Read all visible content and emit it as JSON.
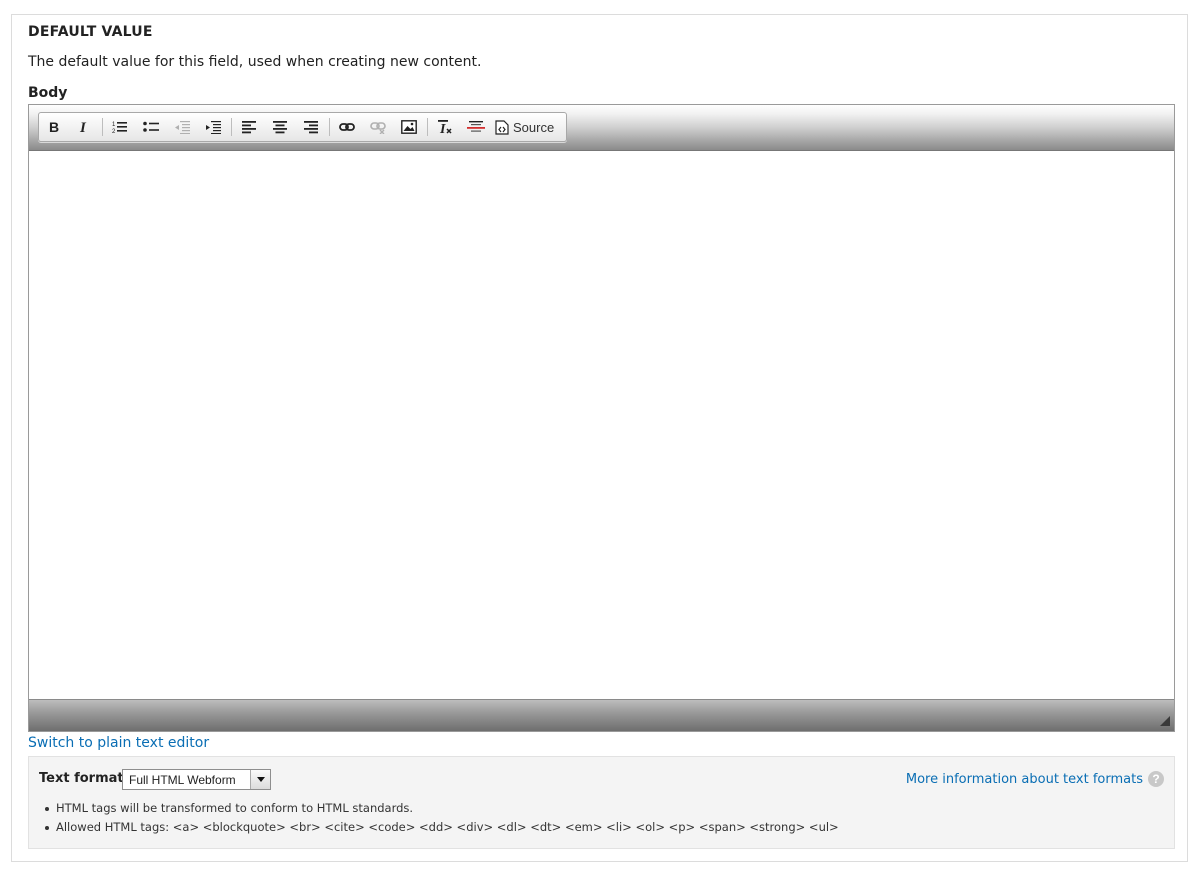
{
  "fieldset": {
    "legend": "DEFAULT VALUE",
    "description": "The default value for this field, used when creating new content."
  },
  "body_field": {
    "label": "Body",
    "content": ""
  },
  "toolbar": {
    "buttons": [
      {
        "name": "bold-icon",
        "title": "B"
      },
      {
        "name": "italic-icon",
        "title": "I"
      },
      {
        "name": "numbered-list-icon"
      },
      {
        "name": "bulleted-list-icon"
      },
      {
        "name": "outdent-icon",
        "disabled": true
      },
      {
        "name": "indent-icon"
      },
      {
        "name": "align-left-icon"
      },
      {
        "name": "align-center-icon"
      },
      {
        "name": "align-right-icon"
      },
      {
        "name": "link-icon"
      },
      {
        "name": "unlink-icon",
        "disabled": true
      },
      {
        "name": "image-icon"
      },
      {
        "name": "remove-format-icon"
      },
      {
        "name": "horizontal-line-icon"
      },
      {
        "name": "source-icon"
      }
    ],
    "source_label": "Source"
  },
  "switch_link": "Switch to plain text editor",
  "text_format": {
    "label": "Text format",
    "selected": "Full HTML Webform",
    "more_info": "More information about text formats",
    "help_icon": "?",
    "tips": [
      "HTML tags will be transformed to conform to HTML standards.",
      "Allowed HTML tags: <a> <blockquote> <br> <cite> <code> <dd> <div> <dl> <dt> <em> <li> <ol> <p> <span> <strong> <ul>"
    ]
  },
  "colors": {
    "link": "#0a6eb4",
    "disabled_icon": "#b0b0b0",
    "remove_format_red": "#d32f2f"
  }
}
